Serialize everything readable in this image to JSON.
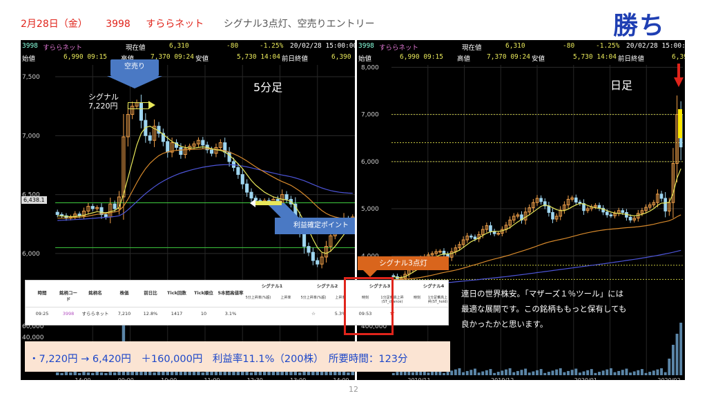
{
  "header": {
    "date": "2月28日（金）",
    "code": "3998",
    "name": "すららネット",
    "note": "シグナル3点灯、空売りエントリー",
    "result": "勝ち"
  },
  "info_bar": {
    "code": "3998",
    "name": "すららネット",
    "cur_label": "現在値",
    "cur_value": "6,310",
    "change": "-80",
    "change_pct": "-1.25%",
    "datetime": "20/02/28 15:00:00",
    "open_label": "始値",
    "open_value": "6,990 09:15",
    "high_label": "高値",
    "high_value": "7,370 09:24",
    "low_label": "安値",
    "low_value": "5,730 14:04",
    "prev_label": "前日終値",
    "prev_value": "6,390",
    "prev_value_cut": "6,39"
  },
  "annotations": {
    "short_sell": "空売り",
    "signal_line1": "シグナル",
    "signal_line2": "7,220円",
    "timeframe_left": "5分足",
    "take_profit": "利益確定ポイント",
    "price_tag": "6,438.1",
    "timeframe_right": "日足",
    "signal3_lit": "シグナル3点灯"
  },
  "signal_table": {
    "headers": [
      "時間",
      "銘柄コード",
      "銘柄名",
      "株価",
      "前日比",
      "Tick回数",
      "Tick順位",
      "5本間高値率"
    ],
    "groups": [
      "シグナル1",
      "シグナル2",
      "シグナル3",
      "シグナル4"
    ],
    "sub_headers": [
      "5分上昇率(%超)",
      "上昇率",
      "5分上昇率(%超)",
      "上昇率",
      "時刻",
      "1分足乗高上昇(ST_chance)",
      "時刻",
      "1分足乗高上昇(ST_hold)"
    ],
    "row": [
      "09:25",
      "3998",
      "すららネット",
      "7,210",
      "12.8%",
      "1417",
      "10",
      "3.1%",
      "",
      "",
      "☆",
      "5.3%",
      "09:53",
      "★",
      "",
      ""
    ]
  },
  "gain_text": "・7,220円 → 6,420円　＋160,000円　利益率11.1%（200株）　所要時間：123分",
  "comment": {
    "line1": "連日の世界株安。「マザーズ１％ツール」には",
    "line2": "最適な展開です。この銘柄ももっと保有しても",
    "line3": "良かったかと思います。"
  },
  "page_number": "12",
  "colors": {
    "header_red": "#e0241b",
    "result_blue": "#1f3fb3",
    "callout_blue": "#4a79c4",
    "callout_orange": "#d9651c",
    "candle_up": "#f3a24a",
    "candle_down": "#9fd6f0",
    "ma_fast": "#e8e85a",
    "ma_mid": "#d88a2c",
    "ma_slow": "#4d55d8",
    "profit_green": "#3fcf3f",
    "gain_bg": "#fbe4d3",
    "gain_text": "#1d47c9"
  },
  "chart_data": [
    {
      "type": "candlestick",
      "title": "5分足",
      "ylim": [
        5700,
        7600
      ],
      "y_ticks": [
        6000,
        6500,
        7000,
        7500
      ],
      "y_tick_labels": [
        "6,000",
        "6,500",
        "7,000",
        "7,500"
      ],
      "x_ticks": [
        "14:00",
        "09:00",
        "10:00",
        "11:00",
        "12:30",
        "13:00",
        "14:00"
      ],
      "volume_ticks": [
        "60,000",
        "40,000"
      ],
      "price_tag": 6438.1,
      "close": [
        6330,
        6320,
        6300,
        6310,
        6335,
        6320,
        6360,
        6400,
        6380,
        6390,
        6330,
        6310,
        6420,
        6380,
        6480,
        6990,
        7180,
        7250,
        7280,
        7130,
        7000,
        6960,
        7080,
        7020,
        6950,
        6860,
        6940,
        6900,
        6840,
        6890,
        6910,
        6930,
        6960,
        6920,
        6880,
        6850,
        6900,
        6940,
        6860,
        6780,
        6730,
        6670,
        6590,
        6520,
        6470,
        6450,
        6440,
        6450,
        6430,
        6460,
        6420,
        6500,
        6460,
        6420,
        6300,
        6190,
        6060,
        6010,
        5940,
        5910,
        5970,
        6060,
        6150,
        6190,
        6220,
        6300,
        6290,
        6310
      ],
      "ma_fast": [
        6320,
        6318,
        6315,
        6312,
        6315,
        6318,
        6325,
        6335,
        6345,
        6355,
        6350,
        6345,
        6355,
        6365,
        6390,
        6500,
        6640,
        6780,
        6920,
        7020,
        7070,
        7080,
        7060,
        7040,
        7010,
        6980,
        6950,
        6930,
        6910,
        6900,
        6895,
        6895,
        6900,
        6905,
        6900,
        6890,
        6880,
        6875,
        6860,
        6835,
        6800,
        6760,
        6720,
        6670,
        6620,
        6580,
        6550,
        6520,
        6500,
        6480,
        6470,
        6460,
        6455,
        6440,
        6400,
        6340,
        6270,
        6200,
        6120,
        6050,
        6010,
        6000,
        6020,
        6060,
        6110,
        6160,
        6200,
        6240
      ],
      "ma_mid": [
        6300,
        6300,
        6300,
        6302,
        6305,
        6308,
        6312,
        6318,
        6325,
        6332,
        6336,
        6340,
        6346,
        6352,
        6362,
        6400,
        6460,
        6530,
        6600,
        6665,
        6720,
        6765,
        6800,
        6830,
        6850,
        6862,
        6870,
        6875,
        6878,
        6880,
        6882,
        6884,
        6886,
        6888,
        6888,
        6886,
        6884,
        6880,
        6872,
        6860,
        6845,
        6828,
        6808,
        6785,
        6760,
        6735,
        6712,
        6690,
        6668,
        6648,
        6628,
        6610,
        6595,
        6578,
        6555,
        6530,
        6500,
        6468,
        6432,
        6396,
        6365,
        6340,
        6322,
        6310,
        6302,
        6298,
        6296,
        6295
      ],
      "ma_slow": [
        6280,
        6282,
        6284,
        6286,
        6288,
        6290,
        6292,
        6295,
        6298,
        6301,
        6304,
        6307,
        6310,
        6314,
        6320,
        6340,
        6370,
        6405,
        6440,
        6475,
        6508,
        6538,
        6566,
        6592,
        6614,
        6634,
        6652,
        6668,
        6682,
        6694,
        6705,
        6715,
        6724,
        6732,
        6738,
        6744,
        6749,
        6752,
        6754,
        6754,
        6752,
        6748,
        6742,
        6735,
        6727,
        6718,
        6709,
        6700,
        6691,
        6683,
        6674,
        6666,
        6659,
        6651,
        6641,
        6630,
        6617,
        6602,
        6586,
        6570,
        6556,
        6544,
        6534,
        6526,
        6520,
        6516,
        6513,
        6511
      ]
    },
    {
      "type": "candlestick",
      "title": "日足",
      "ylim": [
        3300,
        8050
      ],
      "y_ticks": [
        4000,
        5000,
        6000,
        7000,
        8000
      ],
      "y_tick_labels": [
        "4,000",
        "5,000",
        "6,000",
        "7,000",
        "8,000"
      ],
      "x_ticks": [
        "2019/11",
        "2019/12",
        "2020/01",
        "2020/02"
      ],
      "volume_ticks": [
        "400,000"
      ],
      "close": [
        3560,
        3490,
        3530,
        3610,
        3700,
        3780,
        3830,
        3930,
        3980,
        4020,
        4050,
        4090,
        4100,
        4030,
        3970,
        4090,
        4170,
        4240,
        4340,
        4420,
        4400,
        4360,
        4450,
        4560,
        4640,
        4520,
        4470,
        4480,
        4560,
        4650,
        4760,
        4840,
        4870,
        4760,
        4930,
        5020,
        5130,
        5220,
        5150,
        5060,
        4920,
        4780,
        4840,
        4970,
        5080,
        5200,
        5230,
        5140,
        5110,
        4960,
        5000,
        5040,
        5070,
        5010,
        4930,
        4870,
        4850,
        4900,
        4960,
        4920,
        4820,
        4760,
        4800,
        4900,
        4960,
        5030,
        5080,
        5130,
        5310,
        5220,
        4950,
        5130,
        5960,
        7000,
        6310
      ],
      "ma_fast": [
        3560,
        3540,
        3540,
        3560,
        3600,
        3650,
        3700,
        3760,
        3820,
        3880,
        3930,
        3980,
        4020,
        4040,
        4040,
        4050,
        4080,
        4120,
        4180,
        4240,
        4300,
        4340,
        4380,
        4430,
        4480,
        4510,
        4520,
        4520,
        4530,
        4560,
        4600,
        4660,
        4720,
        4770,
        4820,
        4870,
        4930,
        4990,
        5050,
        5080,
        5060,
        5020,
        4980,
        4960,
        4960,
        4990,
        5040,
        5080,
        5110,
        5100,
        5070,
        5040,
        5020,
        5010,
        4990,
        4960,
        4930,
        4910,
        4900,
        4890,
        4880,
        4860,
        4850,
        4860,
        4880,
        4910,
        4950,
        5000,
        5070,
        5120,
        5120,
        5140,
        5320,
        5650,
        5850
      ],
      "ma_mid": [
        3500,
        3500,
        3502,
        3506,
        3512,
        3520,
        3530,
        3542,
        3556,
        3572,
        3590,
        3610,
        3630,
        3648,
        3664,
        3680,
        3698,
        3718,
        3740,
        3764,
        3788,
        3812,
        3836,
        3862,
        3888,
        3912,
        3934,
        3954,
        3974,
        3996,
        4020,
        4046,
        4072,
        4098,
        4124,
        4152,
        4180,
        4210,
        4240,
        4268,
        4292,
        4312,
        4330,
        4348,
        4366,
        4386,
        4408,
        4430,
        4452,
        4472,
        4490,
        4506,
        4522,
        4536,
        4548,
        4558,
        4566,
        4574,
        4582,
        4590,
        4598,
        4604,
        4610,
        4618,
        4628,
        4640,
        4654,
        4670,
        4690,
        4710,
        4726,
        4746,
        4780,
        4830,
        4870
      ],
      "ma_slow": [
        3350,
        3355,
        3360,
        3365,
        3370,
        3375,
        3380,
        3386,
        3392,
        3398,
        3405,
        3412,
        3419,
        3426,
        3433,
        3440,
        3448,
        3456,
        3464,
        3472,
        3480,
        3488,
        3497,
        3506,
        3515,
        3524,
        3533,
        3542,
        3551,
        3560,
        3570,
        3580,
        3590,
        3600,
        3611,
        3622,
        3633,
        3644,
        3655,
        3666,
        3677,
        3688,
        3699,
        3710,
        3721,
        3732,
        3743,
        3754,
        3765,
        3776,
        3787,
        3798,
        3809,
        3820,
        3831,
        3842,
        3854,
        3866,
        3878,
        3890,
        3902,
        3914,
        3926,
        3938,
        3952,
        3966,
        3980,
        3994,
        4010,
        4026,
        4042,
        4058,
        4076,
        4096,
        4116
      ]
    }
  ]
}
